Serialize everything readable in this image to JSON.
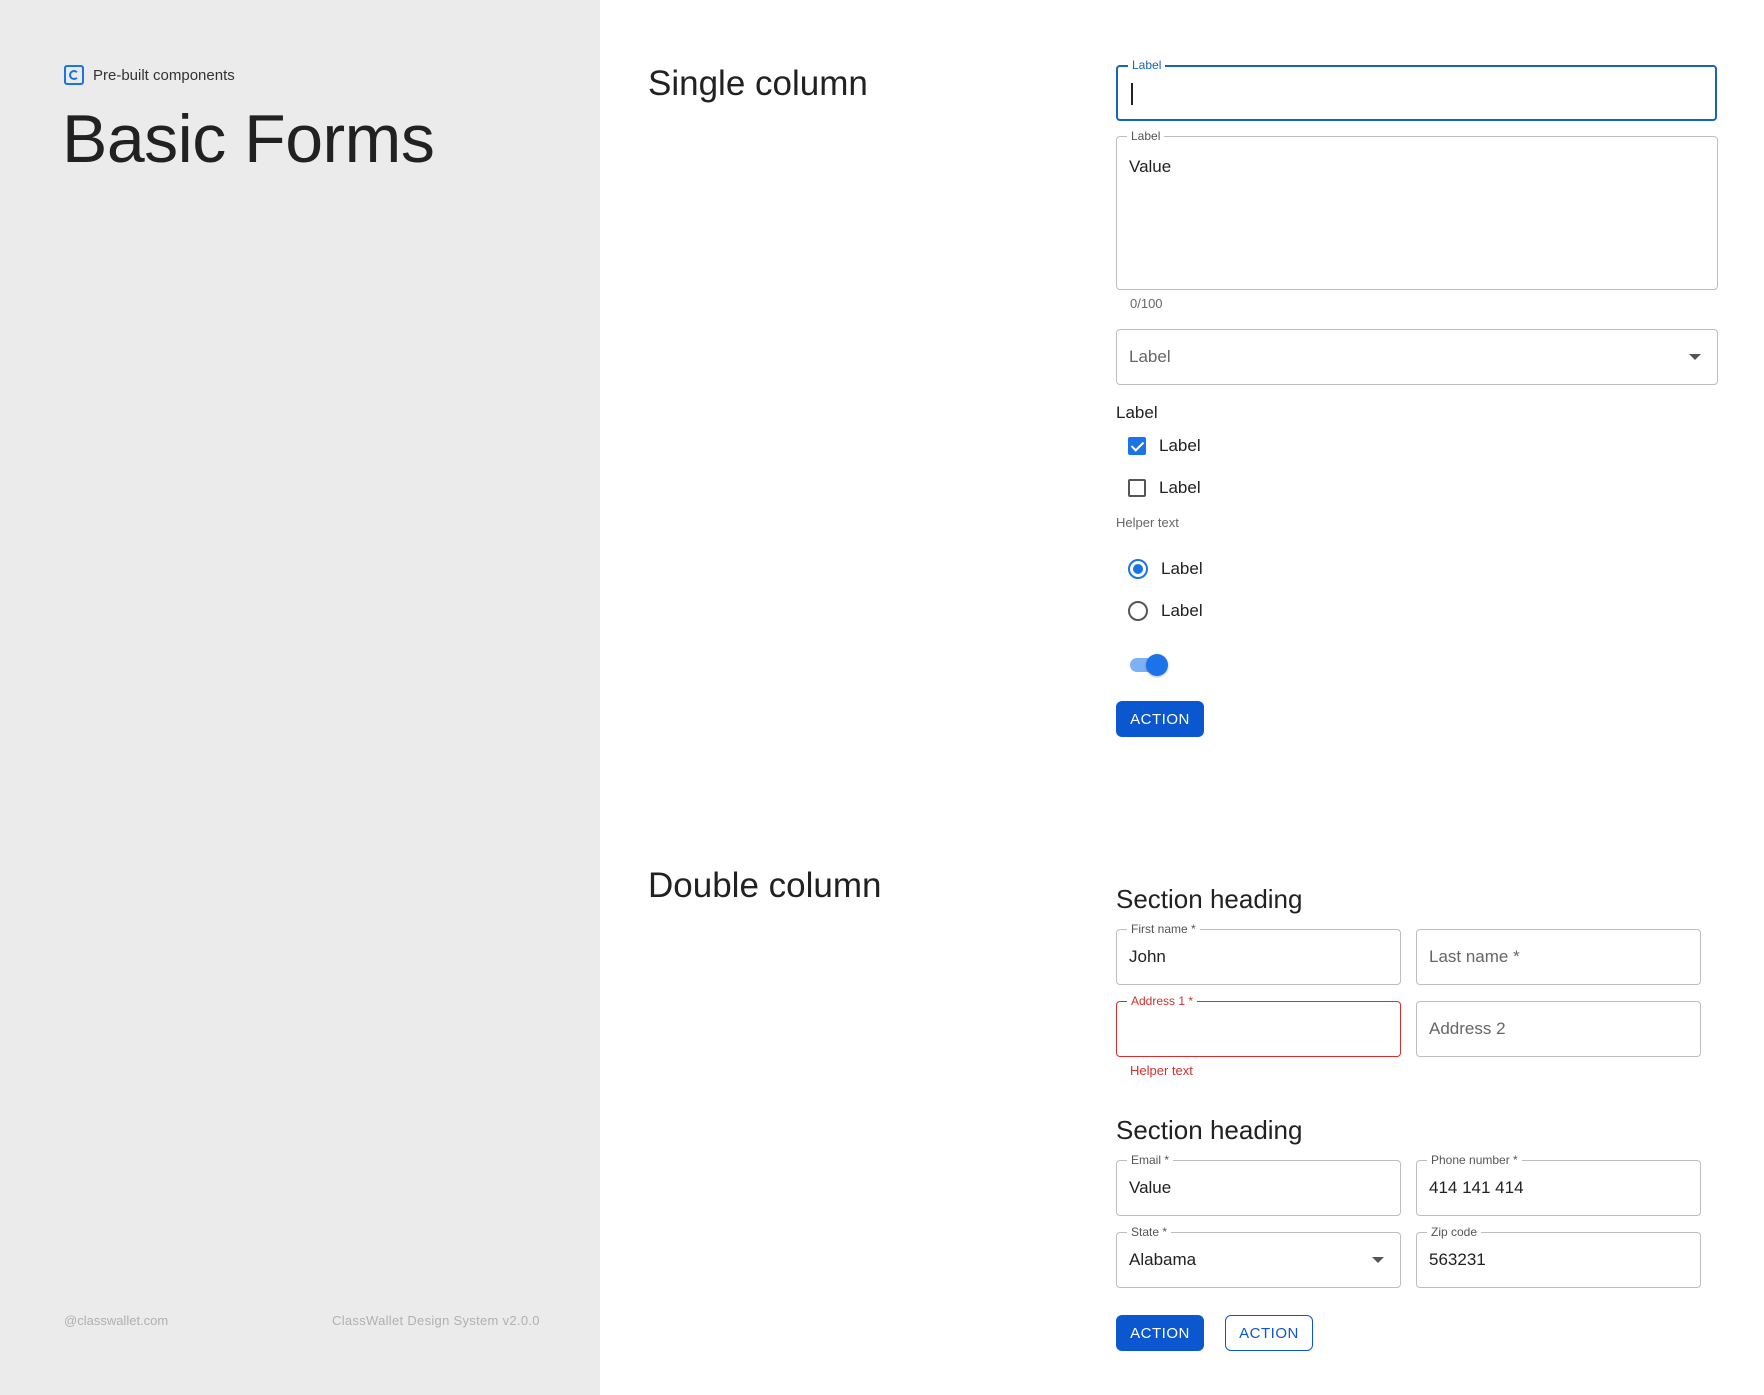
{
  "sidebar": {
    "brand_label": "Pre-built components",
    "title": "Basic Forms",
    "footer_left": "@classwallet.com",
    "footer_right": "ClassWallet Design System v2.0.0"
  },
  "single": {
    "title": "Single column",
    "text_field": {
      "label": "Label"
    },
    "textarea": {
      "label": "Label",
      "value": "Value",
      "counter": "0/100"
    },
    "select": {
      "placeholder": "Label"
    },
    "checkbox_group": {
      "label": "Label",
      "options": [
        {
          "label": "Label",
          "checked": true
        },
        {
          "label": "Label",
          "checked": false
        }
      ],
      "helper": "Helper text"
    },
    "radio_group": {
      "options": [
        {
          "label": "Label",
          "checked": true
        },
        {
          "label": "Label",
          "checked": false
        }
      ]
    },
    "toggle": {
      "on": true
    },
    "action_label": "ACTION"
  },
  "double": {
    "title": "Double column",
    "section1": {
      "heading": "Section heading",
      "first_name": {
        "label": "First name *",
        "value": "John"
      },
      "last_name": {
        "placeholder": "Last name *"
      },
      "address1": {
        "label": "Address 1 *",
        "helper": "Helper text"
      },
      "address2": {
        "placeholder": "Address 2"
      }
    },
    "section2": {
      "heading": "Section heading",
      "email": {
        "label": "Email *",
        "value": "Value"
      },
      "phone": {
        "label": "Phone number *",
        "value": "414 141 414"
      },
      "state": {
        "label": "State *",
        "value": "Alabama"
      },
      "zip": {
        "label": "Zip code",
        "value": "563231"
      }
    },
    "primary_action": "ACTION",
    "secondary_action": "ACTION"
  },
  "colors": {
    "primary": "#0b57d0",
    "accent": "#1a73e8",
    "error": "#d32f2f",
    "sidebar_bg": "#ebebeb"
  }
}
